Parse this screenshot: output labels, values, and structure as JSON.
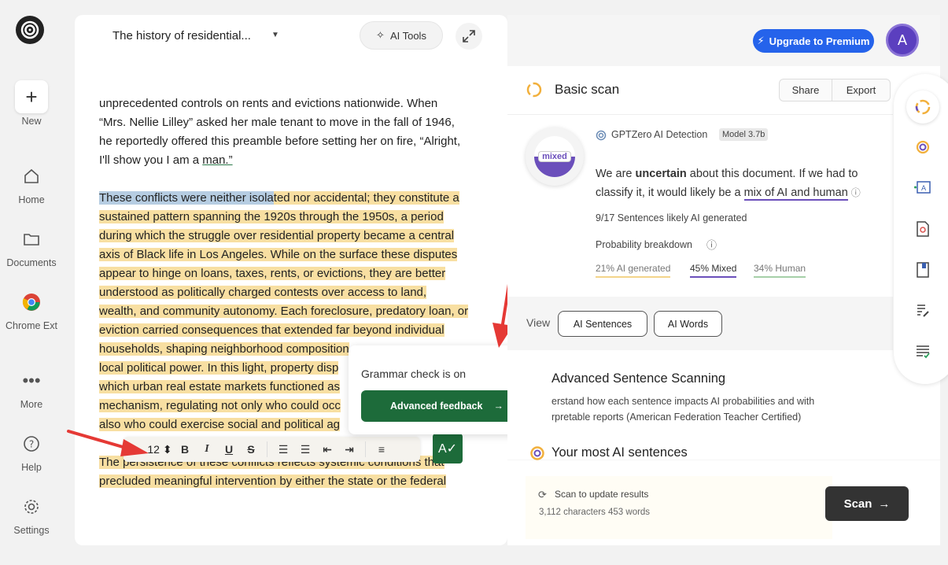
{
  "nav": {
    "new_label": "New",
    "home_label": "Home",
    "documents_label": "Documents",
    "chrome_label": "Chrome Ext",
    "more_label": "More",
    "help_label": "Help",
    "settings_label": "Settings"
  },
  "editor": {
    "title": "The history of residential...",
    "ai_tools_label": "AI Tools",
    "para1": [
      "unprecedented controls on rents and evictions nationwide. When",
      "“Mrs. Nellie Lilley” asked her male tenant to move in the fall of 1946,",
      "he reportedly offered this preamble before setting her on fire, “Alright,"
    ],
    "para1_last_plain": "I'll show you I am a ",
    "para1_last_link": "man.”",
    "p2_l1_sel": "These conflicts were neither isola",
    "p2_l1_rest": "ted nor accidental; they constitute a",
    "p2_lines": [
      "sustained pattern spanning the 1920s through the 1950s, a period",
      "during which the struggle over residential property became a central"
    ],
    "p2_l4_a": "axis of Black life in Los Angeles.",
    "p2_l4_b": " While on the surface these disputes",
    "p2_lines2": [
      "appear to hinge on loans, taxes, rents, or evictions, they are better",
      "understood as politically charged contests over access to land,"
    ],
    "p2_l7_a": "wealth, and community autonomy.",
    "p2_l7_b": " Each foreclosure, predatory loan, or",
    "p2_l8": "eviction carried consequences that extended far beyond individual",
    "p2_l9": "households, shaping neighborhood composition",
    "p2_l10_a": "local political power.",
    "p2_l10_b": " In this light, property disp",
    "p2_l11": "which urban real estate markets functioned as",
    "p2_l12": "mechanism, regulating not only who could occ",
    "p2_l13": "also who could exercise social and political ag",
    "p3_l1": "The persistence of these conflicts reflects systemic conditions that",
    "p3_l2": "precluded meaningful intervention by either the state or the federal",
    "font_size": "12",
    "popup_text": "Grammar check is on",
    "advanced_feedback_label": "Advanced feedback"
  },
  "header": {
    "upgrade_label": "Upgrade to Premium",
    "avatar_initial": "A"
  },
  "scan": {
    "title": "Basic scan",
    "share_label": "Share",
    "export_label": "Export",
    "gauge_label": "mixed",
    "detector_name": "GPTZero AI Detection",
    "model_badge": "Model 3.7b",
    "summary_a": "We are ",
    "summary_b": "uncertain",
    "summary_c": " about this document. If we had to classify it, it would likely be a ",
    "summary_d": "mix of AI and human",
    "sentences_stat": "9/17 Sentences likely AI generated",
    "prob_label": "Probability breakdown",
    "prob_ai": "21% AI generated",
    "prob_mixed": "45% Mixed",
    "prob_human": "34% Human",
    "view_label": "View",
    "view_sentences": "AI Sentences",
    "view_words": "AI Words",
    "adv_title": "Advanced Sentence Scanning",
    "adv_desc_1": "erstand how each sentence impacts AI probabilities and with",
    "adv_desc_2": "rpretable reports (American Federation Teacher Certified)",
    "most_ai_title": "Your most AI sentences",
    "scan_update": "Scan to update results",
    "counts": "3,112 characters 453 words",
    "scan_button": "Scan"
  },
  "colors": {
    "highlight": "#f8dfa2",
    "selection": "#b6cde2",
    "primary_green": "#1d6b3a",
    "premium_blue": "#2563eb",
    "mixed_purple": "#6b4fbb",
    "arrow_red": "#e53935"
  }
}
